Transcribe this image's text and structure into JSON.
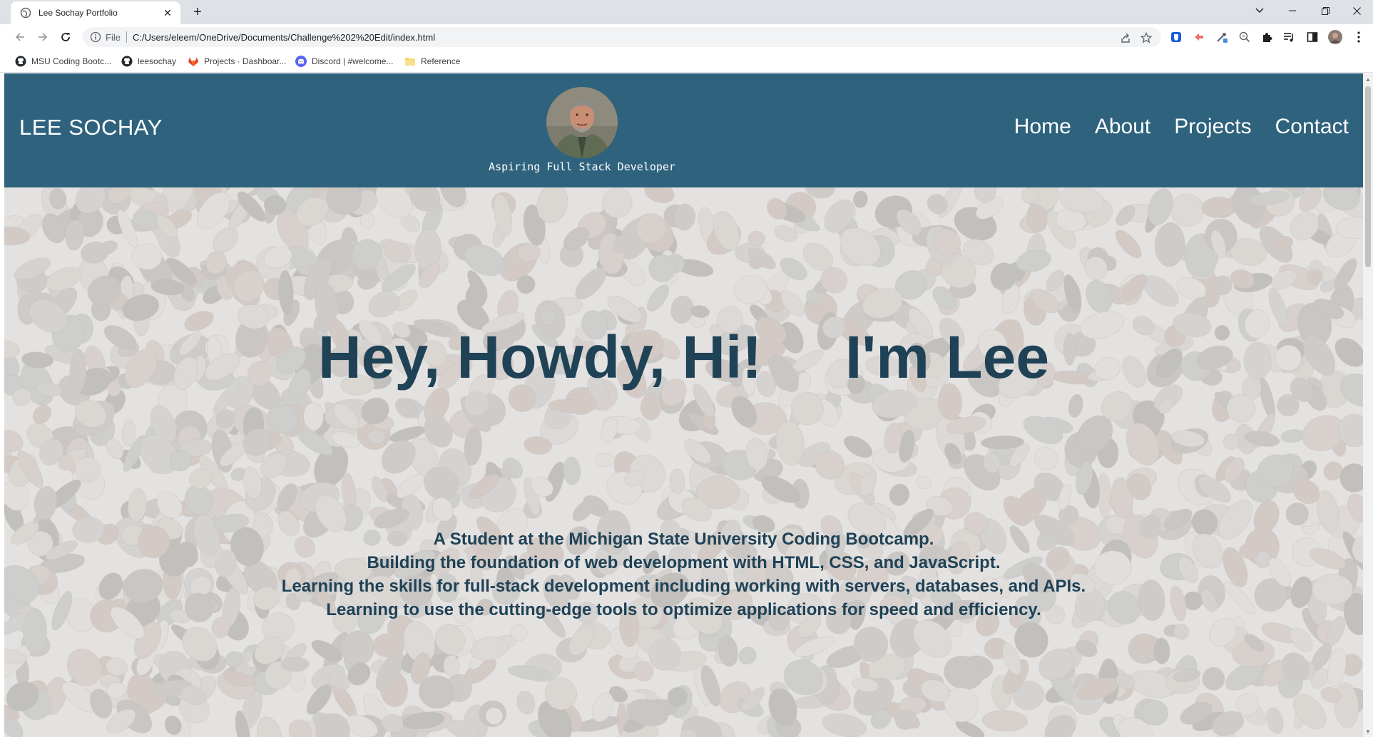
{
  "browser": {
    "tab_title": "Lee Sochay Portfolio",
    "tab_close": "✕",
    "new_tab": "+",
    "url_scheme": "File",
    "url": "C:/Users/eleem/OneDrive/Documents/Challenge%202%20Edit/index.html",
    "bookmarks": [
      {
        "label": "MSU Coding Bootc...",
        "icon": "github-icon"
      },
      {
        "label": "leesochay",
        "icon": "github-icon"
      },
      {
        "label": "Projects · Dashboar...",
        "icon": "gitlab-icon"
      },
      {
        "label": "Discord | #welcome...",
        "icon": "discord-icon"
      },
      {
        "label": "Reference",
        "icon": "folder-icon"
      }
    ]
  },
  "site": {
    "brand": "LEE SOCHAY",
    "tagline": "Aspiring Full Stack Developer",
    "nav": [
      "Home",
      "About",
      "Projects",
      "Contact"
    ],
    "hero_title": "Hey, Howdy, Hi!     I'm Lee",
    "hero_lines": [
      "A Student at the Michigan State University Coding Bootcamp.",
      "Building the foundation of web development with HTML, CSS, and JavaScript.",
      "Learning the skills for full-stack development including working with servers, databases, and APIs.",
      "Learning to use the cutting-edge tools to optimize applications for speed and efficiency."
    ]
  },
  "colors": {
    "header_bg": "#2e627d",
    "hero_text": "#1f4256",
    "chrome_bg": "#dee1e6"
  }
}
